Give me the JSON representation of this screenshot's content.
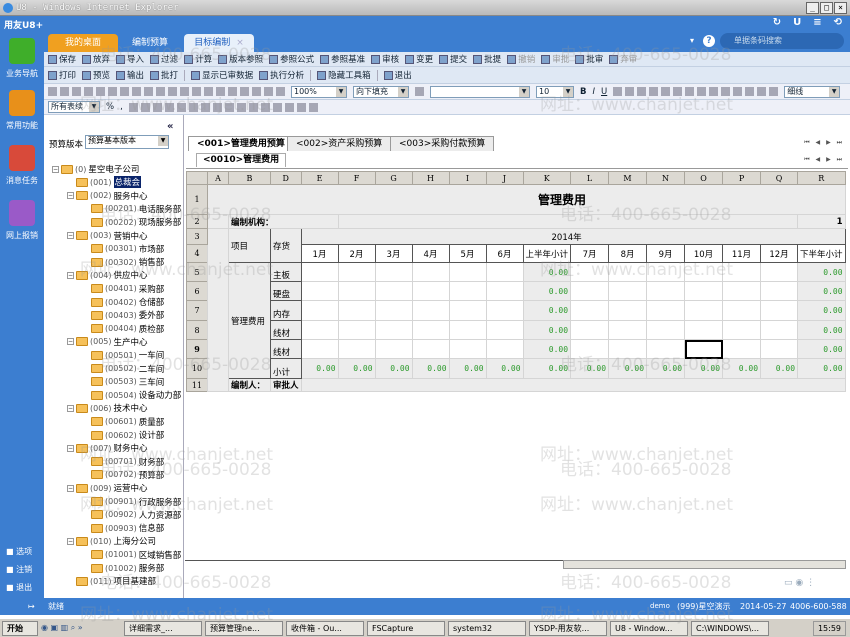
{
  "window": {
    "title": "U8 - Windows Internet Explorer",
    "min": "_",
    "max": "□",
    "close": "×"
  },
  "app": {
    "logo": "用友U8+",
    "tabs": [
      "我的桌面",
      "编制预算",
      "目标编制"
    ],
    "tab_close": "×",
    "search_placeholder": "单据条码搜索",
    "help": "?",
    "dropdown": "▾",
    "top_icons": [
      "↻",
      "U",
      "≡",
      "⟲"
    ]
  },
  "nav": {
    "items": [
      "业务导航",
      "常用功能",
      "消息任务",
      "网上报销"
    ],
    "bottom": [
      "选项",
      "注销",
      "退出"
    ],
    "colors": [
      "#3fae2a",
      "#e8901a",
      "#d84a3a",
      "#9a5ac8"
    ]
  },
  "toolbar1": [
    {
      "l": "保存"
    },
    {
      "l": "放弃"
    },
    {
      "l": "导入"
    },
    {
      "l": "过滤"
    },
    {
      "l": "计算"
    },
    {
      "l": "版本参照"
    },
    {
      "l": "参照公式"
    },
    {
      "l": "参照基准"
    },
    {
      "l": "审核"
    },
    {
      "l": "变更"
    },
    {
      "l": "提交"
    },
    {
      "l": "批提"
    },
    {
      "l": "撤销",
      "dis": true
    },
    {
      "l": "审批",
      "dis": true
    },
    {
      "l": "批审"
    },
    {
      "l": "弃审",
      "dis": true
    }
  ],
  "toolbar2": [
    "打印",
    "预览",
    "输出",
    "批打",
    "显示已审数据",
    "执行分析",
    "隐藏工具箱",
    "退出"
  ],
  "format": {
    "zoom": "100%",
    "fill": "向下填充",
    "font": "",
    "size": "10",
    "border": "细线",
    "bold": "B",
    "italic": "I",
    "underline": "U"
  },
  "format2": {
    "tables": "所有表续",
    "percent": "%",
    "comma": ","
  },
  "left": {
    "collapse": "«",
    "version_label": "预算版本",
    "version": "预算基本版本",
    "tree": [
      {
        "d": 0,
        "c": "(0)",
        "n": "星空电子公司",
        "pm": "−"
      },
      {
        "d": 1,
        "c": "(001)",
        "n": "总裁会",
        "sel": true
      },
      {
        "d": 1,
        "c": "(002)",
        "n": "服务中心",
        "pm": "−"
      },
      {
        "d": 2,
        "c": "(00201)",
        "n": "电话服务部"
      },
      {
        "d": 2,
        "c": "(00202)",
        "n": "现场服务部"
      },
      {
        "d": 1,
        "c": "(003)",
        "n": "营销中心",
        "pm": "−"
      },
      {
        "d": 2,
        "c": "(00301)",
        "n": "市场部"
      },
      {
        "d": 2,
        "c": "(00302)",
        "n": "销售部"
      },
      {
        "d": 1,
        "c": "(004)",
        "n": "供应中心",
        "pm": "−"
      },
      {
        "d": 2,
        "c": "(00401)",
        "n": "采购部"
      },
      {
        "d": 2,
        "c": "(00402)",
        "n": "仓储部"
      },
      {
        "d": 2,
        "c": "(00403)",
        "n": "委外部"
      },
      {
        "d": 2,
        "c": "(00404)",
        "n": "质检部"
      },
      {
        "d": 1,
        "c": "(005)",
        "n": "生产中心",
        "pm": "−"
      },
      {
        "d": 2,
        "c": "(00501)",
        "n": "一车间"
      },
      {
        "d": 2,
        "c": "(00502)",
        "n": "二车间"
      },
      {
        "d": 2,
        "c": "(00503)",
        "n": "三车间"
      },
      {
        "d": 2,
        "c": "(00504)",
        "n": "设备动力部"
      },
      {
        "d": 1,
        "c": "(006)",
        "n": "技术中心",
        "pm": "−"
      },
      {
        "d": 2,
        "c": "(00601)",
        "n": "质量部"
      },
      {
        "d": 2,
        "c": "(00602)",
        "n": "设计部"
      },
      {
        "d": 1,
        "c": "(007)",
        "n": "财务中心",
        "pm": "−"
      },
      {
        "d": 2,
        "c": "(00701)",
        "n": "财务部"
      },
      {
        "d": 2,
        "c": "(00702)",
        "n": "预算部"
      },
      {
        "d": 1,
        "c": "(009)",
        "n": "运营中心",
        "pm": "−"
      },
      {
        "d": 2,
        "c": "(00901)",
        "n": "行政服务部"
      },
      {
        "d": 2,
        "c": "(00902)",
        "n": "人力资源部"
      },
      {
        "d": 2,
        "c": "(00903)",
        "n": "信息部"
      },
      {
        "d": 1,
        "c": "(010)",
        "n": "上海分公司",
        "pm": "−"
      },
      {
        "d": 2,
        "c": "(01001)",
        "n": "区域销售部"
      },
      {
        "d": 2,
        "c": "(01002)",
        "n": "服务部"
      },
      {
        "d": 1,
        "c": "(011)",
        "n": "项目基建部"
      }
    ]
  },
  "sheet": {
    "tabs": [
      "<001>管理费用预算",
      "<002>资产采购预算",
      "<003>采购付款预算"
    ],
    "subtab": "<0010>管理费用",
    "nav": "⏮ ◀ ▶ ⏭",
    "columns": [
      "A",
      "B",
      "D",
      "E",
      "F",
      "G",
      "H",
      "I",
      "J",
      "K",
      "L",
      "M",
      "N",
      "O",
      "P",
      "Q",
      "R"
    ],
    "rows": [
      "1",
      "2",
      "3",
      "4",
      "5",
      "6",
      "7",
      "8",
      "9",
      "10",
      "11"
    ],
    "title": "管理费用",
    "org_label": "编制机构：",
    "page_no": "1",
    "item_header": "项目",
    "stock_header": "存货",
    "year": "2014年",
    "months": [
      "1月",
      "2月",
      "3月",
      "4月",
      "5月",
      "6月",
      "上半年小计",
      "7月",
      "8月",
      "9月",
      "10月",
      "11月",
      "12月",
      "下半年小计"
    ],
    "category": "管理费用",
    "items": [
      "主板",
      "硬盘",
      "内存",
      "线材",
      "线材",
      "小计"
    ],
    "zero": "0.00",
    "preparer": "编制人：",
    "approver": "审批人"
  },
  "status": {
    "ready": "就绪",
    "user": "demo",
    "account": "(999)星空演示",
    "date": "2014-05-27",
    "phone": "4006-600-588"
  },
  "taskbar": {
    "start": "开始",
    "tasks": [
      "详细需求_...",
      "预算管理ne...",
      "收件箱 - Ou...",
      "FSCapture",
      "system32",
      "YSDP-用友软...",
      "U8 - Window...",
      "C:\\WINDOWS\\..."
    ],
    "time": "15:59"
  },
  "watermark": {
    "phone": "电话：400-665-0028",
    "site": "网址：www.chanjet.net"
  }
}
